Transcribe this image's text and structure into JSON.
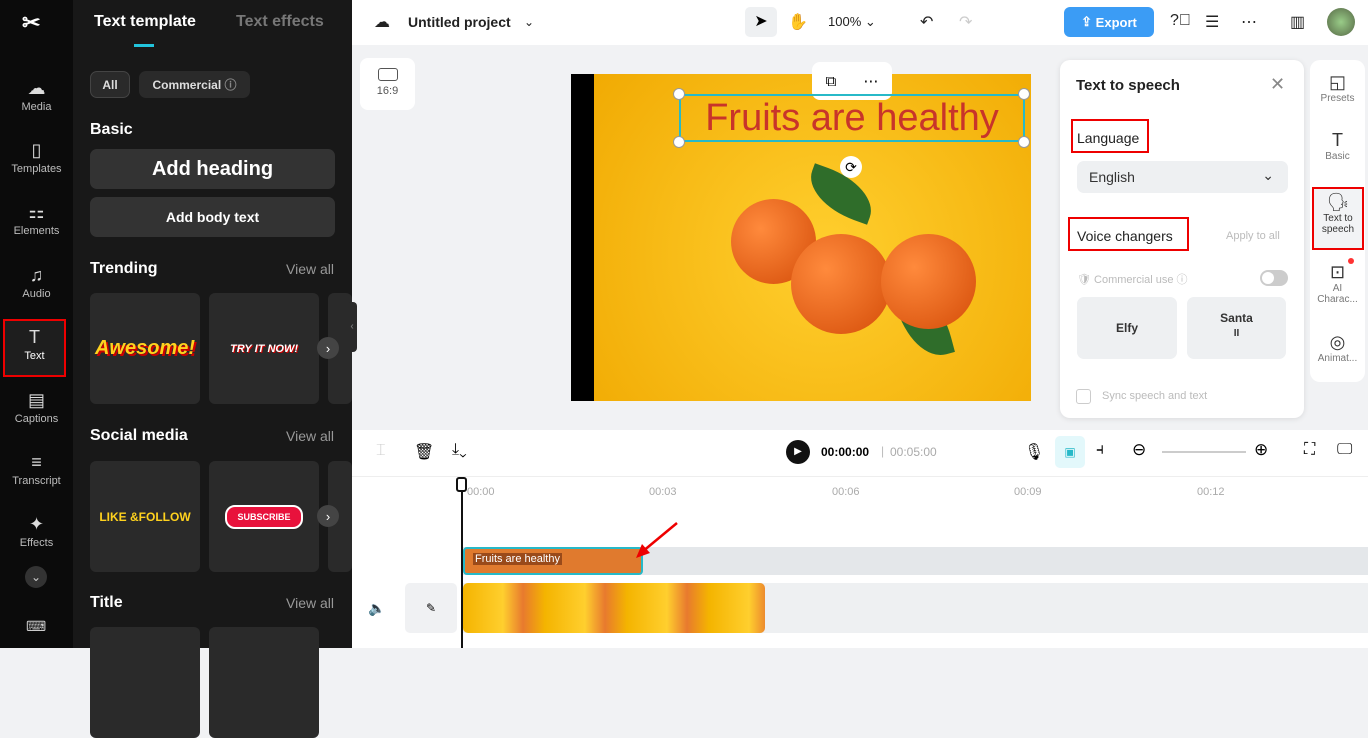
{
  "rail": {
    "items": [
      {
        "label": "Media",
        "icon": "cloud-upload-icon"
      },
      {
        "label": "Templates",
        "icon": "templates-icon"
      },
      {
        "label": "Elements",
        "icon": "elements-icon"
      },
      {
        "label": "Audio",
        "icon": "music-icon"
      },
      {
        "label": "Text",
        "icon": "text-icon"
      },
      {
        "label": "Captions",
        "icon": "captions-icon"
      },
      {
        "label": "Transcript",
        "icon": "transcript-icon"
      },
      {
        "label": "Effects",
        "icon": "effects-icon"
      }
    ]
  },
  "panel": {
    "tabs": [
      "Text template",
      "Text effects"
    ],
    "filters": [
      "All",
      "Commercial"
    ],
    "basic": "Basic",
    "add_heading": "Add heading",
    "add_body": "Add body text",
    "view_all": "View all",
    "sections": [
      "Trending",
      "Social media",
      "Title"
    ],
    "trending_thumbs": [
      "Awesome!",
      "TRY IT NOW!"
    ],
    "social_thumbs": [
      "LIKE &FOLLOW",
      "SUBSCRIBE"
    ]
  },
  "topbar": {
    "project": "Untitled project",
    "zoom": "100%",
    "export": "Export"
  },
  "canvas": {
    "ratio": "16:9",
    "overlay_text": "Fruits are healthy"
  },
  "tts": {
    "title": "Text to speech",
    "language_label": "Language",
    "language_value": "English",
    "voice_label": "Voice changers",
    "apply_all": "Apply to all",
    "commercial": "Commercial use",
    "voices": [
      "Elfy",
      "Santa"
    ],
    "sync": "Sync speech and text",
    "commercial_toggle": false
  },
  "right_rail": [
    {
      "label": "Presets"
    },
    {
      "label": "Basic"
    },
    {
      "label": "Text to speech"
    },
    {
      "label": "AI Charac..."
    },
    {
      "label": "Animat..."
    }
  ],
  "timeline": {
    "current": "00:00:00",
    "total": "00:05:00",
    "ticks": [
      "00:00",
      "00:03",
      "00:06",
      "00:09",
      "00:12"
    ],
    "text_clip": "Fruits are healthy"
  },
  "colors": {
    "accent": "#3b9cf5",
    "highlight": "#e00000",
    "clip": "#e07a2e"
  }
}
